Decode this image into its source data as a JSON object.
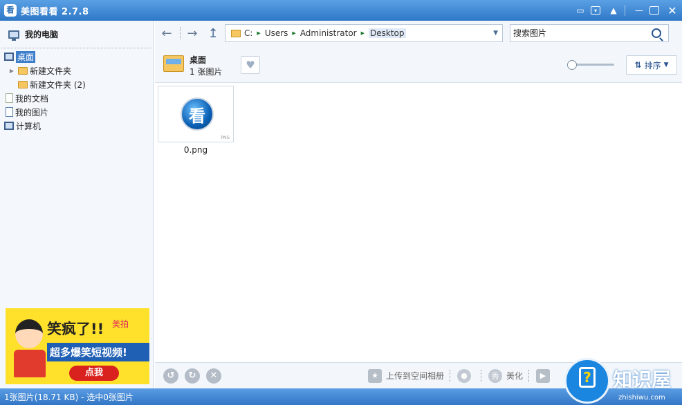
{
  "window": {
    "title": "美图看看 2.7.8",
    "logo_text": "看",
    "controls": [
      "message-icon",
      "dropdown-icon",
      "skin-icon",
      "minimize-icon",
      "maximize-icon",
      "close-icon"
    ]
  },
  "sidebar": {
    "header": "我的电脑",
    "tree": [
      {
        "label": "桌面",
        "icon": "desktop-icon",
        "selected": true,
        "indent": 0
      },
      {
        "label": "新建文件夹",
        "icon": "folder-icon",
        "expandable": true,
        "indent": 1
      },
      {
        "label": "新建文件夹 (2)",
        "icon": "folder-icon",
        "indent": 1
      },
      {
        "label": "我的文档",
        "icon": "document-icon",
        "indent": 0
      },
      {
        "label": "我的图片",
        "icon": "pictures-icon",
        "indent": 0
      },
      {
        "label": "计算机",
        "icon": "computer-icon",
        "indent": 0
      }
    ],
    "ad": {
      "headline": "笑疯了!!",
      "brand": "美拍",
      "tagline": "超多爆笑短视频!",
      "cta": "点我"
    }
  },
  "navbar": {
    "path": {
      "drive": "C:",
      "crumbs": [
        "Users",
        "Administrator",
        "Desktop"
      ]
    },
    "search_placeholder": "搜索图片"
  },
  "infobar": {
    "folder_name": "桌面",
    "image_count": "1 张图片",
    "zoom_level": 0.1,
    "sort_label": "排序"
  },
  "thumbnails": [
    {
      "filename": "0.png",
      "ext": "PNG",
      "glyph": "看"
    }
  ],
  "bottombar": {
    "actions": [
      {
        "label": "上传到空间相册",
        "icon": "upload-album-icon"
      },
      {
        "label": "",
        "icon": "weibo-icon"
      },
      {
        "label": "美化",
        "icon": "beautify-icon"
      },
      {
        "label": "",
        "icon": "slideshow-icon"
      }
    ]
  },
  "status": {
    "text": "1张图片(18.71 KB) - 选中0张图片"
  },
  "watermark": {
    "brand": "知识屋",
    "url": "zhishiwu.com"
  },
  "colors": {
    "titlebar": "#2f78c7",
    "selection": "#3d7ecb",
    "ad_background": "#ffe02a"
  }
}
